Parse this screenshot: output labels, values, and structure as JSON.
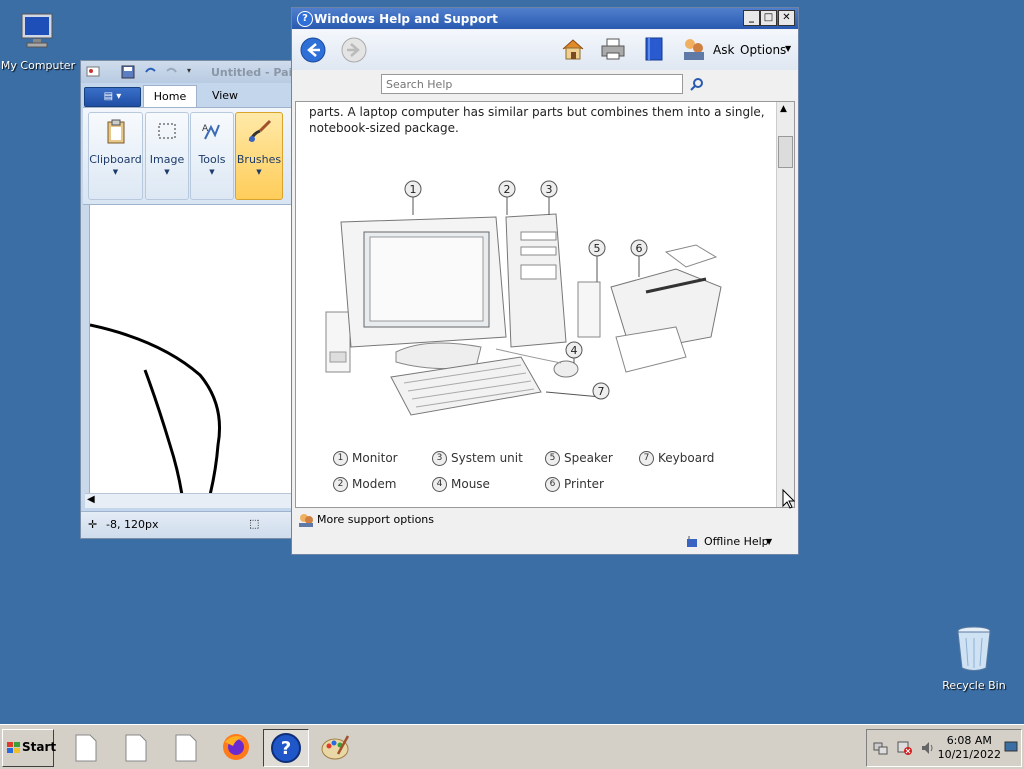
{
  "desktop": {
    "my_computer_label": "My Computer",
    "recycle_bin_label": "Recycle Bin"
  },
  "paint": {
    "title": "Untitled - Pain",
    "tabs": [
      {
        "label": "Home"
      },
      {
        "label": "View"
      }
    ],
    "groups": [
      {
        "label": "Clipboard"
      },
      {
        "label": "Image"
      },
      {
        "label": "Tools"
      },
      {
        "label": "Brushes"
      }
    ],
    "status_coords": "-8, 120px"
  },
  "help": {
    "title": "Windows Help and Support",
    "toolbar": {
      "ask_label": "Ask",
      "options_label": "Options"
    },
    "search_placeholder": "Search Help",
    "paragraph": "parts. A laptop computer has similar parts but combines them into a single, notebook-sized package.",
    "callouts": [
      "1",
      "2",
      "3",
      "4",
      "5",
      "6",
      "7"
    ],
    "legend": [
      {
        "num": "1",
        "label": "Monitor"
      },
      {
        "num": "3",
        "label": "System unit"
      },
      {
        "num": "5",
        "label": "Speaker"
      },
      {
        "num": "7",
        "label": "Keyboard"
      },
      {
        "num": "2",
        "label": "Modem"
      },
      {
        "num": "4",
        "label": "Mouse"
      },
      {
        "num": "6",
        "label": "Printer"
      }
    ],
    "more_support": "More support options",
    "offline_help": "Offline Help"
  },
  "taskbar": {
    "start_label": "Start",
    "time": "6:08 AM",
    "date": "10/21/2022"
  },
  "colors": {
    "desktop": "#3a6ea5",
    "help_title": "#2a5ab0"
  }
}
